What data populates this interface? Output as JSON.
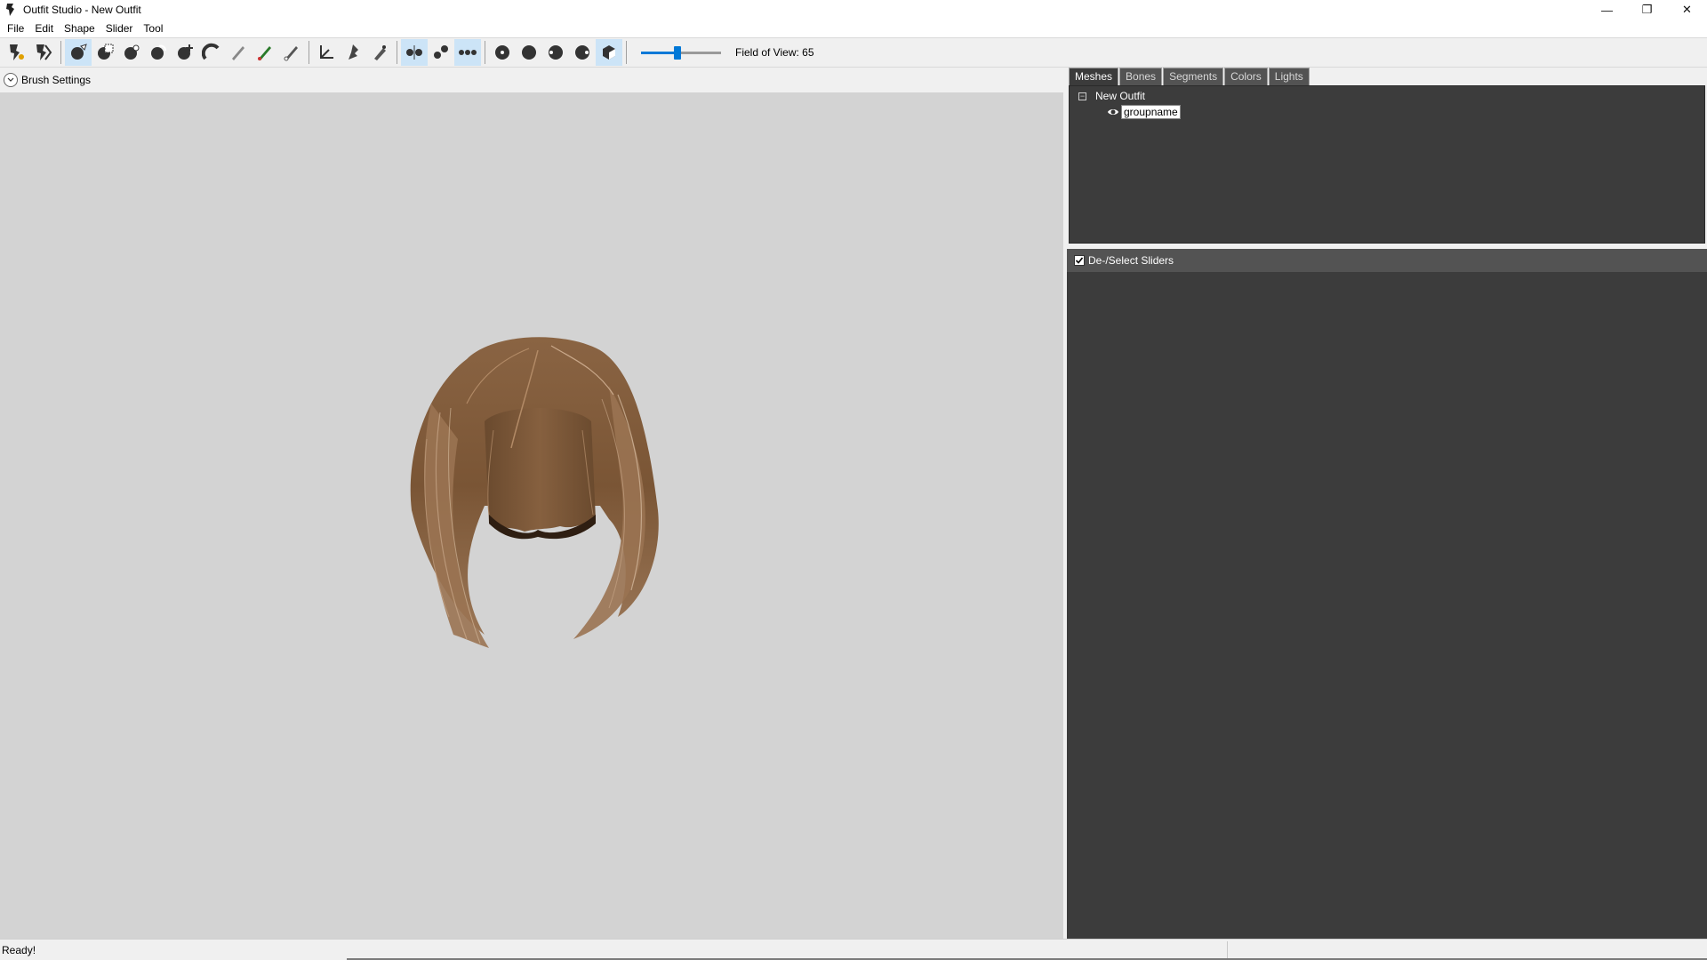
{
  "window": {
    "title": "Outfit Studio - New Outfit",
    "controls": {
      "minimize": "—",
      "maximize": "❐",
      "close": "✕"
    }
  },
  "menu": [
    "File",
    "Edit",
    "Shape",
    "Slider",
    "Tool"
  ],
  "toolbar": {
    "field_of_view_label": "Field of View: 65",
    "field_of_view_fraction": 0.45
  },
  "viewport": {
    "brush_settings_label": "Brush Settings"
  },
  "tabs": [
    "Meshes",
    "Bones",
    "Segments",
    "Colors",
    "Lights"
  ],
  "tree": {
    "root_label": "New Outfit",
    "child_label": "groupname"
  },
  "sliders": {
    "header_label": "De-/Select Sliders"
  },
  "status": {
    "text": "Ready!"
  },
  "colors": {
    "accent": "#0078d7",
    "panel_dark": "#3c3c3c",
    "viewport_bg": "#d3d3d3",
    "hair": "#8a6443"
  }
}
